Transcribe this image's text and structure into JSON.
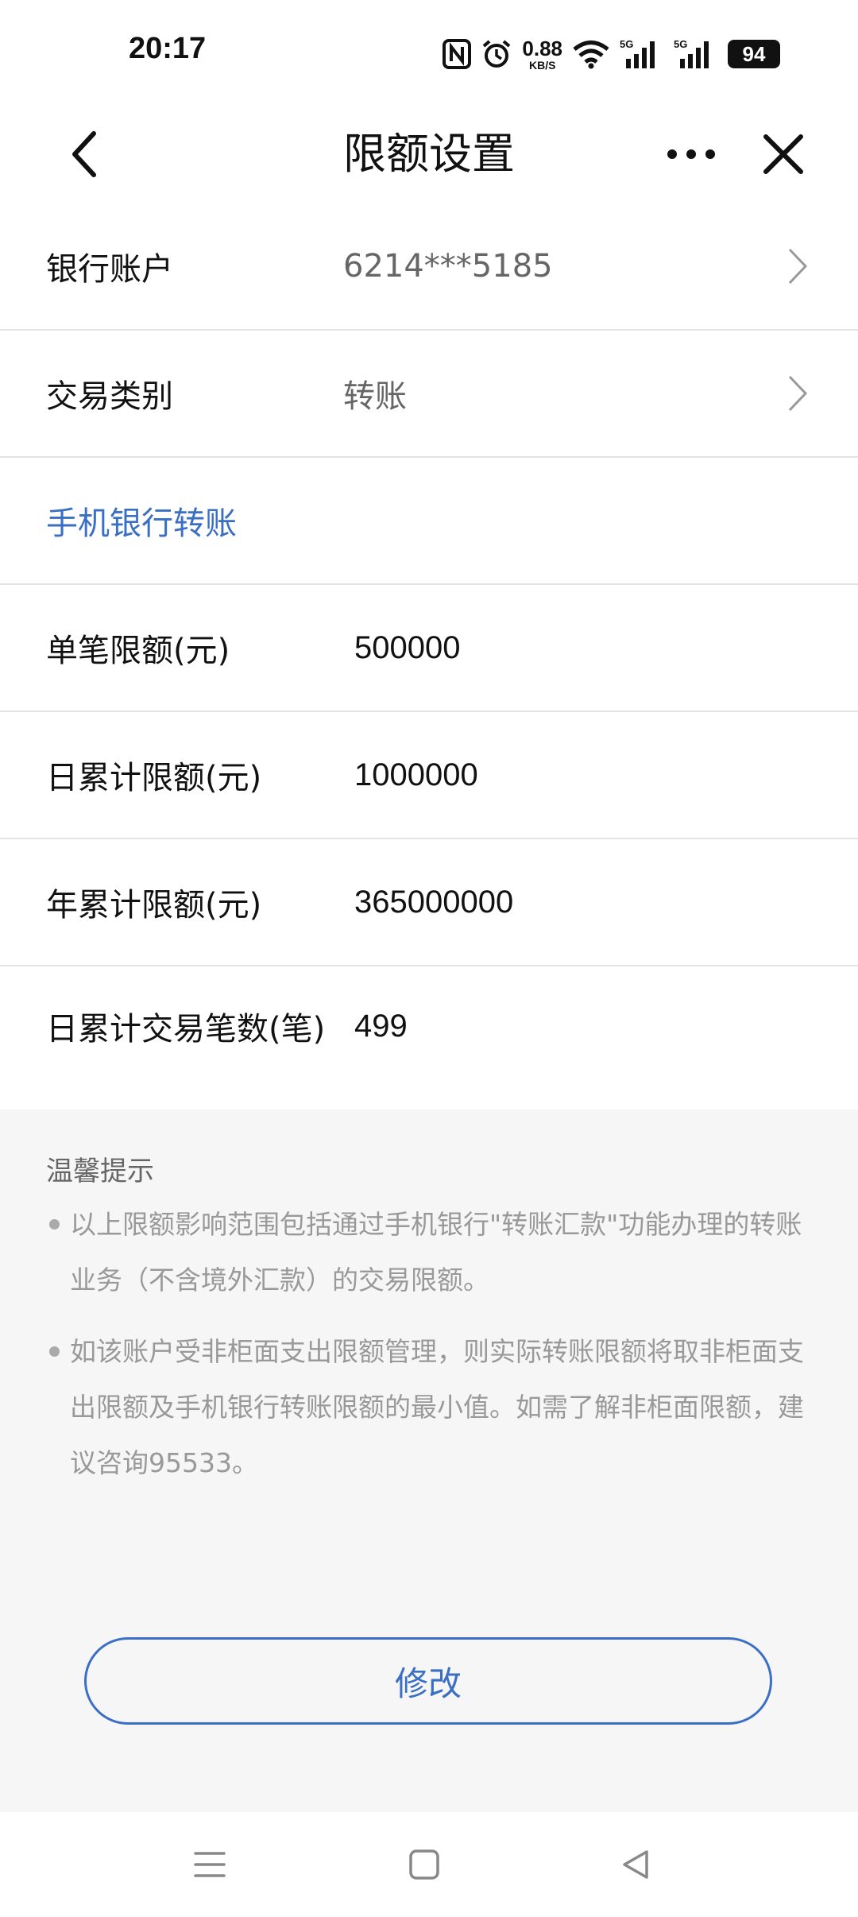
{
  "status_bar": {
    "time": "20:17",
    "net_speed_value": "0.88",
    "net_speed_unit": "KB/S",
    "signal1_label": "5G",
    "signal2_label": "5G",
    "battery": "94"
  },
  "header": {
    "title": "限额设置"
  },
  "form": {
    "account": {
      "label": "银行账户",
      "value": "6214***5185"
    },
    "category": {
      "label": "交易类别",
      "value": "转账"
    },
    "section_title": "手机银行转账",
    "limits": [
      {
        "label": "单笔限额(元)",
        "value": "500000"
      },
      {
        "label": "日累计限额(元)",
        "value": "1000000"
      },
      {
        "label": "年累计限额(元)",
        "value": "365000000"
      },
      {
        "label": "日累计交易笔数(笔)",
        "value": "499"
      }
    ]
  },
  "tips": {
    "title": "温馨提示",
    "items": [
      "以上限额影响范围包括通过手机银行\"转账汇款\"功能办理的转账业务（不含境外汇款）的交易限额。",
      "如该账户受非柜面支出限额管理，则实际转账限额将取非柜面支出限额及手机银行转账限额的最小值。如需了解非柜面限额，建议咨询95533。"
    ]
  },
  "actions": {
    "modify_label": "修改"
  },
  "colors": {
    "accent": "#3a6fc4",
    "tips_bg": "#f6f6f6"
  },
  "icons": {
    "back": "chevron-left-icon",
    "more": "more-dots-icon",
    "close": "close-icon",
    "row_arrow": "chevron-right-icon",
    "nav_menu": "menu-icon",
    "nav_home": "home-square-icon",
    "nav_back": "triangle-back-icon"
  }
}
